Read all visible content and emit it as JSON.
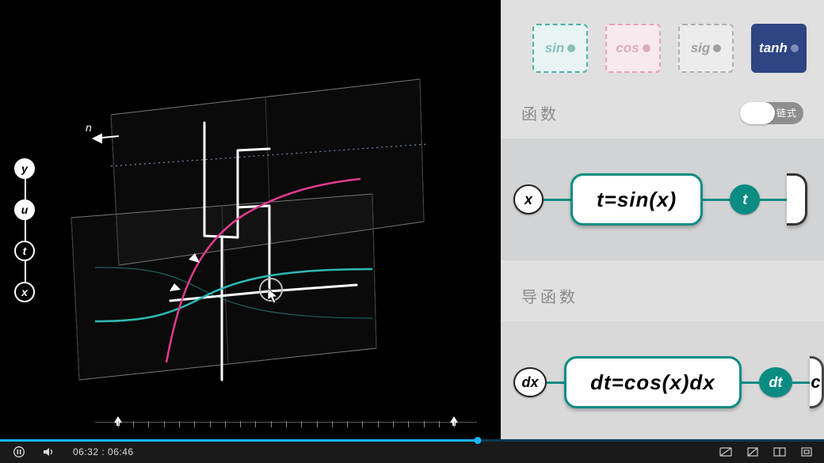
{
  "axis_chips": {
    "y": "y",
    "u": "u",
    "t": "t",
    "x": "x"
  },
  "scene": {
    "plane_label_n": "n"
  },
  "panel": {
    "functions": {
      "sin": "sin",
      "cos": "cos",
      "sig": "sig",
      "tanh": "tanh",
      "selected": "tanh"
    },
    "titles": {
      "function": "函数",
      "derivative": "导函数"
    },
    "toggle": {
      "state": "off",
      "label": "链式"
    },
    "chain": {
      "var_in": "x",
      "expr1": "t=sin(x)",
      "mid": "t"
    },
    "derivative": {
      "var_in": "dx",
      "expr1": "dt=cos(x)dx",
      "mid": "dt",
      "peek": "c"
    }
  },
  "player": {
    "current": "06:32",
    "sep": " : ",
    "total": "06:46",
    "progress_pct": 58
  },
  "colors": {
    "teal": "#0a8c83",
    "pink": "#e23a8f",
    "cyan": "#2fb9b4",
    "white": "#ffffff",
    "panel": "#e0e0e0",
    "accent_blue": "#19b6ff",
    "fn_tanh_bg": "#2e4583"
  }
}
